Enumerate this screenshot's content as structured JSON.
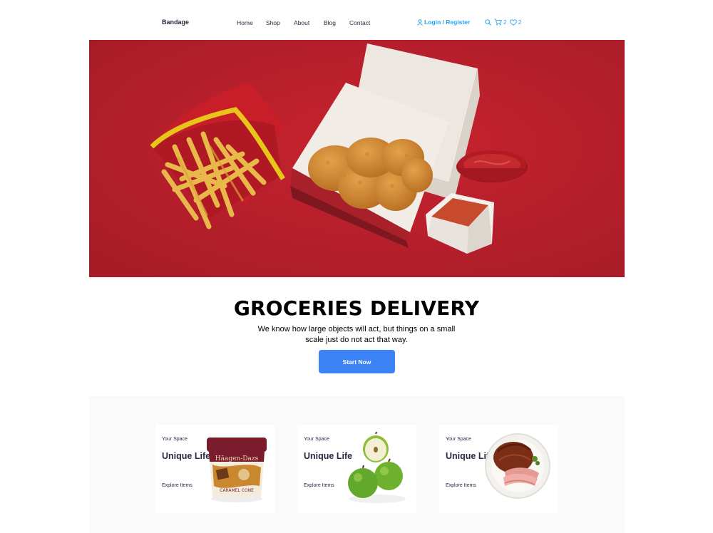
{
  "nav": {
    "brand": "Bandage",
    "links": [
      "Home",
      "Shop",
      "About",
      "Blog",
      "Contact"
    ],
    "login_label": "Login / Register",
    "cart_count": "2",
    "wishlist_count": "2"
  },
  "hero": {
    "image_alt": "fries, chicken nuggets and ketchup on red background",
    "title": "GROCERIES DELIVERY",
    "description": "We know how large objects will act, but things on a small scale just do not act that way.",
    "cta_label": "Start Now"
  },
  "cards": [
    {
      "kicker": "Your Space",
      "title": "Unique Life",
      "explore": "Explore Items",
      "image": "ice-cream-tub"
    },
    {
      "kicker": "Your Space",
      "title": "Unique Life",
      "explore": "Explore Items",
      "image": "green-apples"
    },
    {
      "kicker": "Your Space",
      "title": "Unique Life",
      "explore": "Explore Items",
      "image": "ham-plate"
    }
  ],
  "colors": {
    "accent": "#23A6F0",
    "cta": "#3B82F6",
    "hero_bg": "#B3202C",
    "text": "#252B42"
  }
}
